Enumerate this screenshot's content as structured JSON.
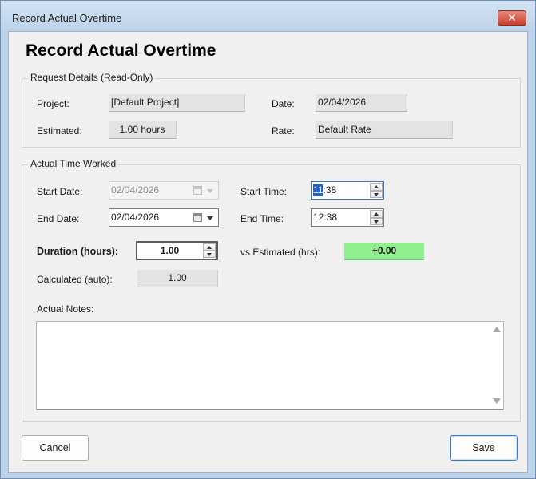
{
  "window": {
    "title": "Record Actual Overtime",
    "close_glyph": "✕"
  },
  "heading": "Record Actual Overtime",
  "request_details": {
    "group_title": "Request Details (Read-Only)",
    "project_label": "Project:",
    "project_value": "[Default Project]",
    "date_label": "Date:",
    "date_value": "02/04/2026",
    "estimated_label": "Estimated:",
    "estimated_value": "1.00 hours",
    "rate_label": "Rate:",
    "rate_value": "Default Rate"
  },
  "actual_time": {
    "group_title": "Actual Time Worked",
    "start_date_label": "Start Date:",
    "start_date_value": "02/04/2026",
    "start_date_enabled": false,
    "end_date_label": "End Date:",
    "end_date_value": "02/04/2026",
    "start_time_label": "Start Time:",
    "start_time_hour": "11",
    "start_time_rest": ":38",
    "end_time_label": "End Time:",
    "end_time_value": "12:38",
    "duration_label": "Duration (hours):",
    "duration_value": "1.00",
    "vs_estimated_label": "vs Estimated (hrs):",
    "vs_estimated_value": "+0.00",
    "vs_estimated_color": "#90ee90",
    "calculated_label": "Calculated (auto):",
    "calculated_value": "1.00",
    "notes_label": "Actual Notes:",
    "notes_value": ""
  },
  "buttons": {
    "cancel": "Cancel",
    "save": "Save"
  },
  "icons": {
    "calendar": "calendar-icon",
    "dropdown": "chevron-down-icon",
    "spin_up": "arrow-up-icon",
    "spin_down": "arrow-down-icon"
  }
}
